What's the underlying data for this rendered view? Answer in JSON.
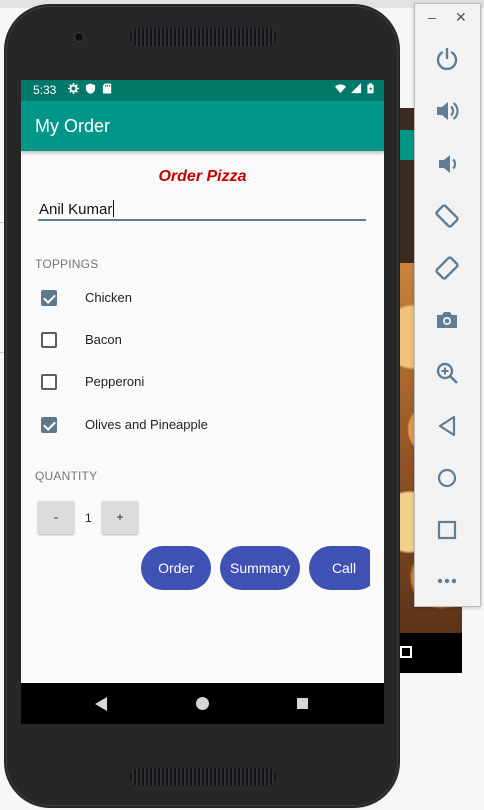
{
  "status_bar": {
    "time": "5:33"
  },
  "app_bar": {
    "title": "My Order"
  },
  "form": {
    "heading": "Order Pizza",
    "name_value": "Anil Kumar",
    "toppings_label": "TOPPINGS",
    "toppings": [
      {
        "label": "Chicken",
        "checked": true
      },
      {
        "label": "Bacon",
        "checked": false
      },
      {
        "label": "Pepperoni",
        "checked": false
      },
      {
        "label": "Olives and Pineapple",
        "checked": true
      }
    ],
    "quantity_label": "QUANTITY",
    "decrement_label": "-",
    "quantity_value": "1",
    "increment_label": "+",
    "actions": {
      "order": "Order",
      "summary": "Summary",
      "call": "Call"
    }
  },
  "colors": {
    "status_bar": "#00796b",
    "app_bar": "#009688",
    "heading": "#c40000",
    "action_button": "#3f51b5",
    "checkbox_checked": "#5c7a8c"
  },
  "emulator_toolbar": {
    "window_controls": [
      "minimize",
      "close"
    ],
    "buttons": [
      "power-icon",
      "volume-up-icon",
      "volume-down-icon",
      "rotate-left-icon",
      "rotate-right-icon",
      "camera-icon",
      "zoom-icon",
      "back-icon",
      "home-icon",
      "overview-icon",
      "more-icon"
    ]
  }
}
